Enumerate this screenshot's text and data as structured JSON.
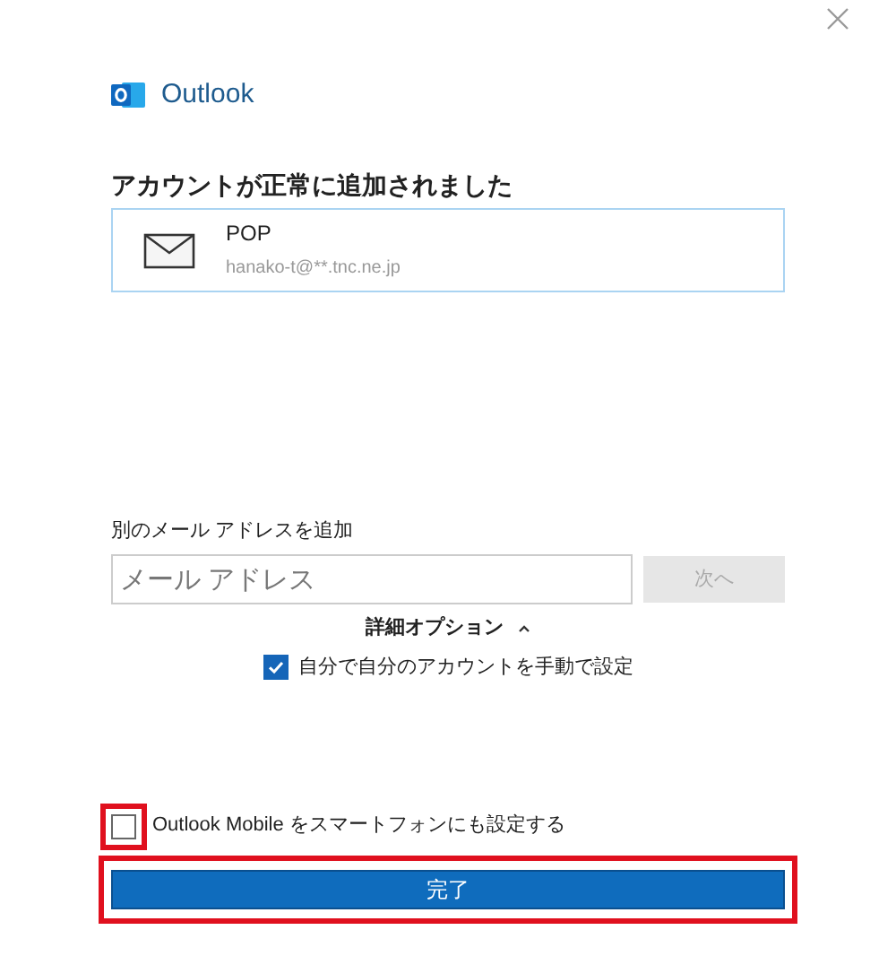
{
  "brand": {
    "name": "Outlook"
  },
  "heading": "アカウントが正常に追加されました",
  "account": {
    "type": "POP",
    "email": "hanako-t@**.tnc.ne.jp"
  },
  "add_email": {
    "label": "別のメール アドレスを追加",
    "placeholder": "メール アドレス",
    "next_button": {
      "label": "次へ",
      "disabled": true
    }
  },
  "advanced": {
    "label": "詳細オプション",
    "expanded": true,
    "manual_setup": {
      "label": "自分で自分のアカウントを手動で設定",
      "checked": true
    }
  },
  "mobile_setup": {
    "label": "Outlook Mobile をスマートフォンにも設定する",
    "checked": false,
    "highlighted": true
  },
  "done_button": {
    "label": "完了",
    "highlighted": true
  }
}
